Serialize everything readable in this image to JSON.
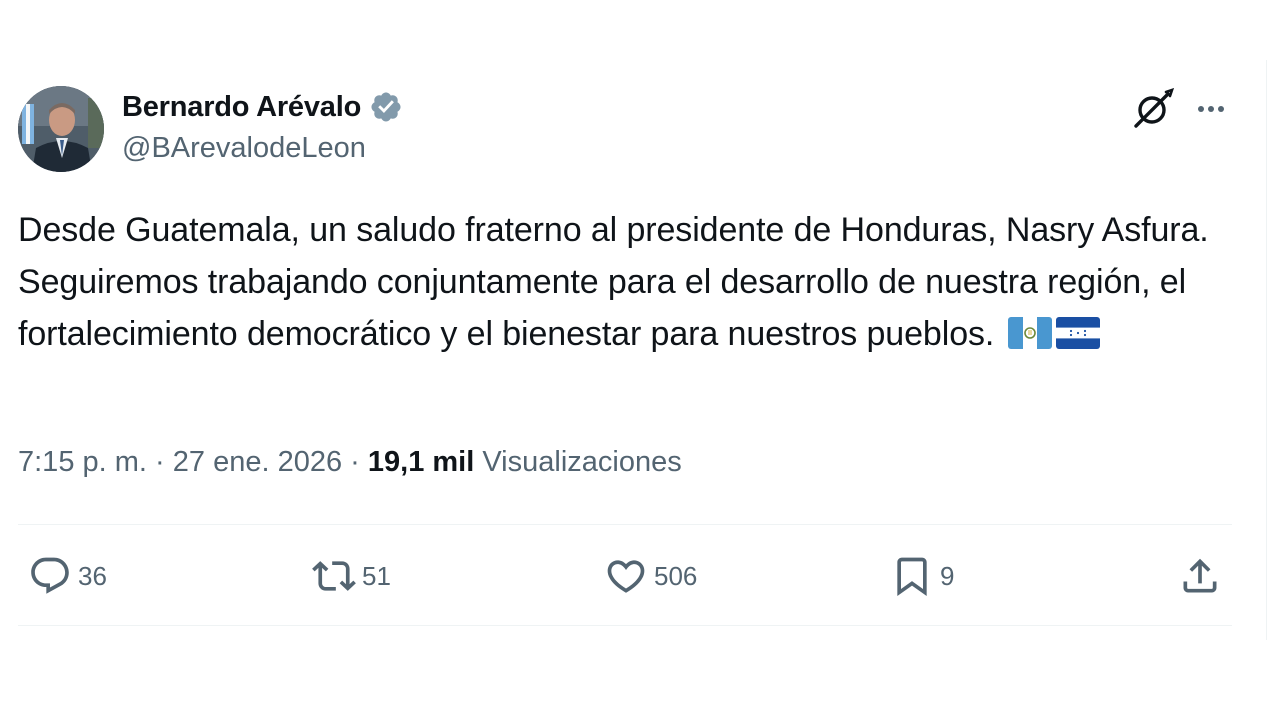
{
  "author": {
    "display_name": "Bernardo Arévalo",
    "handle": "@BArevalodeLeon",
    "verified_icon": "verified-badge-icon",
    "verified_color": "#829aab"
  },
  "tweet": {
    "text": "Desde Guatemala, un saludo fraterno al presidente de Honduras, Nasry Asfura. Seguiremos trabajando conjuntamente para el desarrollo de nuestra región, el fortalecimiento democrático y el bienestar para nuestros pueblos.",
    "flags": [
      "guatemala-flag-icon",
      "honduras-flag-icon"
    ]
  },
  "meta": {
    "time": "7:15 p. m.",
    "separator": "·",
    "date": "27 ene. 2026",
    "views_count": "19,1 mil",
    "views_label": "Visualizaciones"
  },
  "actions": {
    "replies": "36",
    "reposts": "51",
    "likes": "506",
    "bookmarks": "9"
  },
  "colors": {
    "text_primary": "#0f1419",
    "text_secondary": "#536471",
    "divider": "#eff3f4"
  }
}
